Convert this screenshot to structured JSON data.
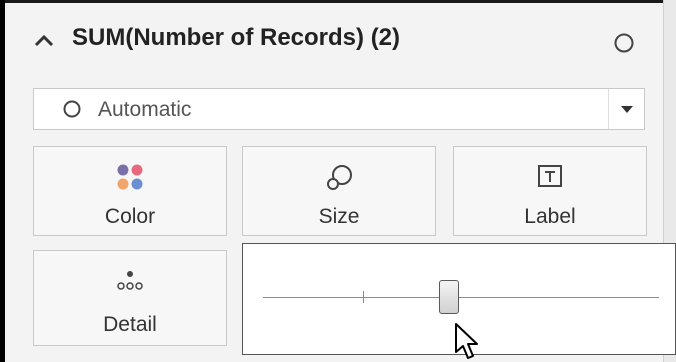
{
  "card": {
    "title": "SUM(Number of Records) (2)",
    "collapse_icon": "chevron-up-icon",
    "options_icon": "circle-icon"
  },
  "mark_type": {
    "selected": "Automatic",
    "icon": "circle-icon"
  },
  "tiles": [
    {
      "label": "Color",
      "icon": "color-dots-icon"
    },
    {
      "label": "Size",
      "icon": "size-icon"
    },
    {
      "label": "Label",
      "icon": "text-box-icon"
    },
    {
      "label": "Detail",
      "icon": "detail-dots-icon"
    }
  ],
  "size_slider": {
    "value_fraction": 0.47
  },
  "colors": {
    "dot_purple": "#7b6fa8",
    "dot_pink": "#e8697e",
    "dot_orange": "#f2a46b",
    "dot_blue": "#6b8fd1"
  }
}
